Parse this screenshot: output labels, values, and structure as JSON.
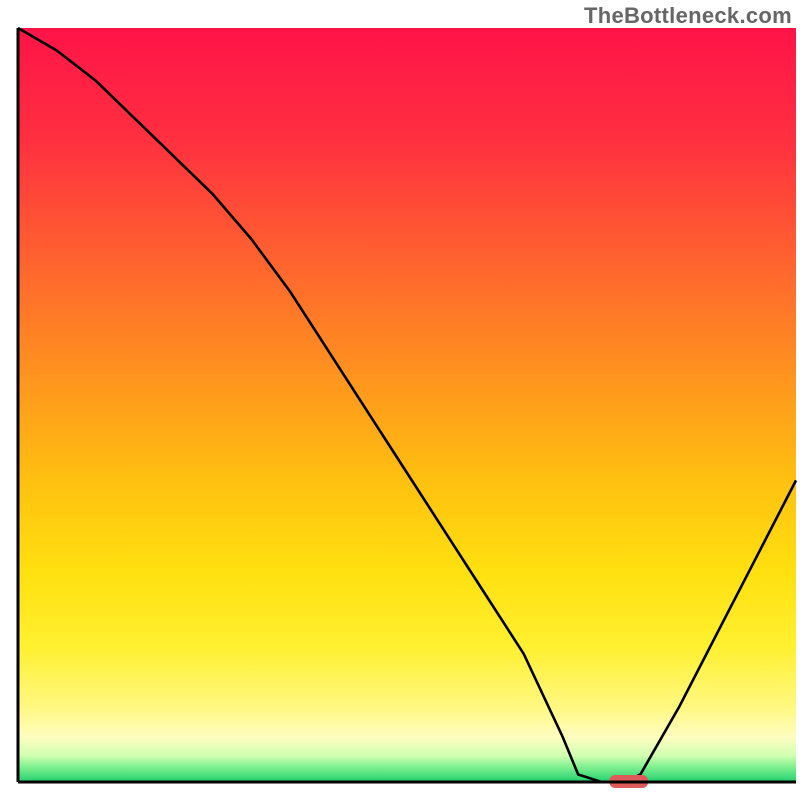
{
  "watermark": "TheBottleneck.com",
  "chart_data": {
    "type": "line",
    "title": "",
    "xlabel": "",
    "ylabel": "",
    "xlim": [
      0,
      100
    ],
    "ylim": [
      0,
      100
    ],
    "x": [
      0,
      5,
      10,
      15,
      20,
      25,
      30,
      35,
      40,
      45,
      50,
      55,
      60,
      65,
      70,
      72,
      75,
      78,
      80,
      85,
      90,
      95,
      100
    ],
    "values": [
      100,
      97,
      93,
      88,
      83,
      78,
      72,
      65,
      57,
      49,
      41,
      33,
      25,
      17,
      6,
      1,
      0,
      0,
      1,
      10,
      20,
      30,
      40
    ],
    "gradient_stops": [
      {
        "offset": 0,
        "color": "#ff1448"
      },
      {
        "offset": 15,
        "color": "#ff3040"
      },
      {
        "offset": 30,
        "color": "#ff6030"
      },
      {
        "offset": 45,
        "color": "#ff9020"
      },
      {
        "offset": 60,
        "color": "#ffc010"
      },
      {
        "offset": 72,
        "color": "#ffe010"
      },
      {
        "offset": 82,
        "color": "#fff030"
      },
      {
        "offset": 90,
        "color": "#fff880"
      },
      {
        "offset": 94,
        "color": "#fffdc0"
      },
      {
        "offset": 96.5,
        "color": "#d0ffb0"
      },
      {
        "offset": 98,
        "color": "#80f090"
      },
      {
        "offset": 100,
        "color": "#20d070"
      }
    ],
    "marker": {
      "x": 76,
      "y": 0,
      "width": 5,
      "color": "#e05a5a"
    }
  }
}
